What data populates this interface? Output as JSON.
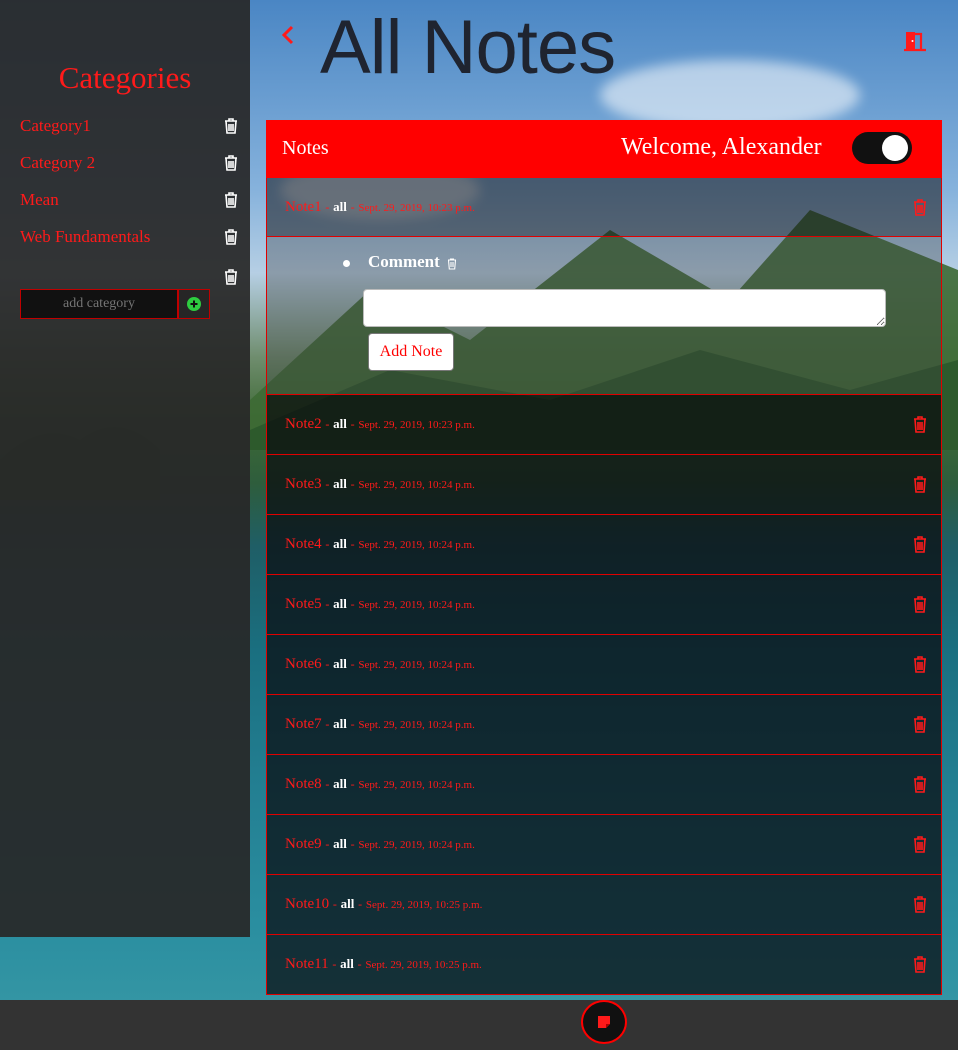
{
  "sidebar": {
    "title": "Categories",
    "categories": [
      {
        "label": "Category1"
      },
      {
        "label": "Category 2"
      },
      {
        "label": "Mean"
      },
      {
        "label": "Web Fundamentals"
      },
      {
        "label": ""
      }
    ],
    "add_placeholder": "add category"
  },
  "header": {
    "title": "All Notes"
  },
  "notes": {
    "header_label": "Notes",
    "welcome": "Welcome, Alexander",
    "toggle_on": true,
    "items": [
      {
        "name": "Note1",
        "category": "all",
        "date": "Sept. 29, 2019, 10:23 p.m."
      },
      {
        "name": "Note2",
        "category": "all",
        "date": "Sept. 29, 2019, 10:23 p.m."
      },
      {
        "name": "Note3",
        "category": "all",
        "date": "Sept. 29, 2019, 10:24 p.m."
      },
      {
        "name": "Note4",
        "category": "all",
        "date": "Sept. 29, 2019, 10:24 p.m."
      },
      {
        "name": "Note5",
        "category": "all",
        "date": "Sept. 29, 2019, 10:24 p.m."
      },
      {
        "name": "Note6",
        "category": "all",
        "date": "Sept. 29, 2019, 10:24 p.m."
      },
      {
        "name": "Note7",
        "category": "all",
        "date": "Sept. 29, 2019, 10:24 p.m."
      },
      {
        "name": "Note8",
        "category": "all",
        "date": "Sept. 29, 2019, 10:24 p.m."
      },
      {
        "name": "Note9",
        "category": "all",
        "date": "Sept. 29, 2019, 10:24 p.m."
      },
      {
        "name": "Note10",
        "category": "all",
        "date": "Sept. 29, 2019, 10:25 p.m."
      },
      {
        "name": "Note11",
        "category": "all",
        "date": "Sept. 29, 2019, 10:25 p.m."
      }
    ],
    "separator": "-",
    "expanded": {
      "comment": "Comment",
      "textarea_value": "",
      "add_button": "Add Note"
    }
  },
  "colors": {
    "accent": "#ff0000",
    "sidebar_bg": "#282828",
    "footer_bg": "#333333"
  },
  "icons": {
    "back": "chevron-left-icon",
    "logout": "door-exit-icon",
    "delete": "trash-icon",
    "add": "plus-circle-icon",
    "footer": "note-icon"
  }
}
